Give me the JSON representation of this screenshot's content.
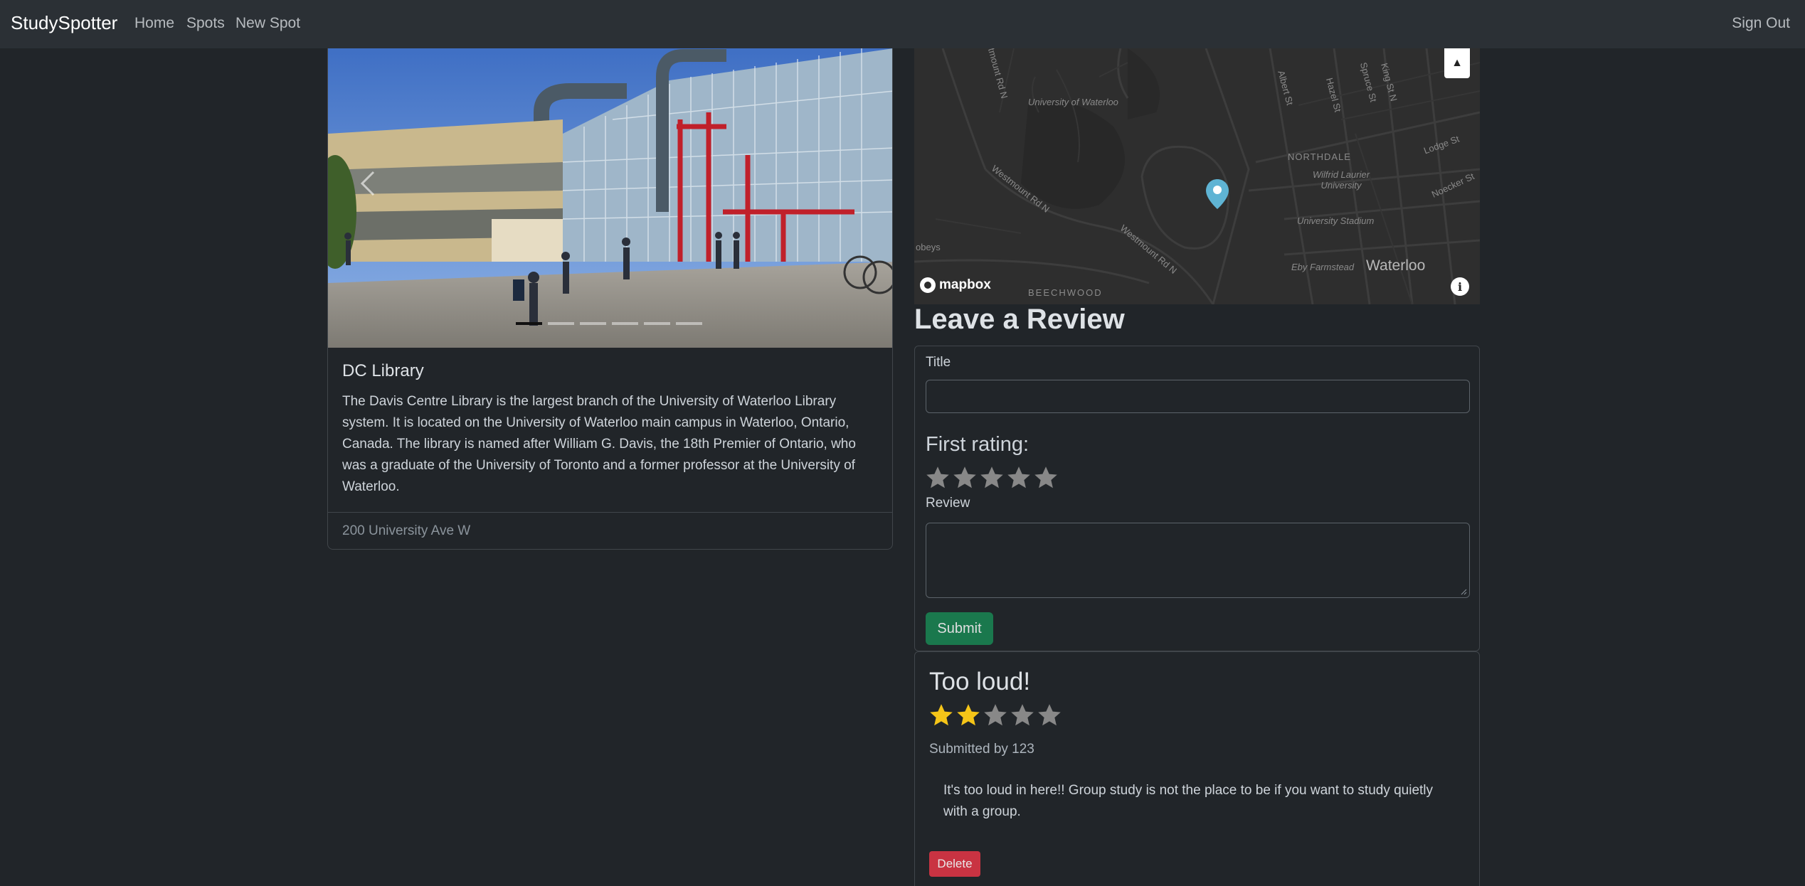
{
  "nav": {
    "brand": "StudySpotter",
    "links": [
      "Home",
      "Spots",
      "New Spot"
    ],
    "sign_out": "Sign Out"
  },
  "spot": {
    "title": "DC Library",
    "description": "The Davis Centre Library is the largest branch of the University of Waterloo Library system. It is located on the University of Waterloo main campus in Waterloo, Ontario, Canada. The library is named after William G. Davis, the 18th Premier of Ontario, who was a graduate of the University of Toronto and a former professor at the University of Waterloo.",
    "address": "200 University Ave W",
    "carousel_slides": 6,
    "active_slide": 1
  },
  "map": {
    "labels": {
      "university": "University of Waterloo",
      "westmount1": "Westmount Rd N",
      "westmount2": "Westmount Rd N",
      "westmount3": "Westmount Rd N",
      "northdale": "NORTHDALE",
      "wilfrid": "Wilfrid Laurier University",
      "stadium": "University Stadium",
      "farmstead": "Eby Farmstead",
      "waterloo": "Waterloo",
      "beechwood": "BEECHWOOD",
      "albert": "Albert St",
      "hazel": "Hazel St",
      "king": "King St N",
      "spruce": "Spruce St",
      "lodge": "Lodge St",
      "noecker": "Noecker St",
      "obeys": "obeys"
    },
    "attribution": "mapbox",
    "info_symbol": "i",
    "compass_symbol": "▲",
    "marker_color": "#5fb4d4"
  },
  "review_form": {
    "heading": "Leave a Review",
    "title_label": "Title",
    "rating_label": "First rating:",
    "review_label": "Review",
    "submit_label": "Submit",
    "rating_value": 0,
    "max_rating": 5
  },
  "reviews": [
    {
      "title": "Too loud!",
      "rating": 2,
      "max_rating": 5,
      "author": "Submitted by 123",
      "body": "It's too loud in here!! Group study is not the place to be if you want to study quietly with a group.",
      "delete_label": "Delete"
    }
  ],
  "colors": {
    "background": "#212529",
    "navbar": "#2b3035",
    "star_filled": "#f5c518",
    "star_empty": "#888888",
    "submit": "#198754",
    "delete": "#dc3545"
  }
}
